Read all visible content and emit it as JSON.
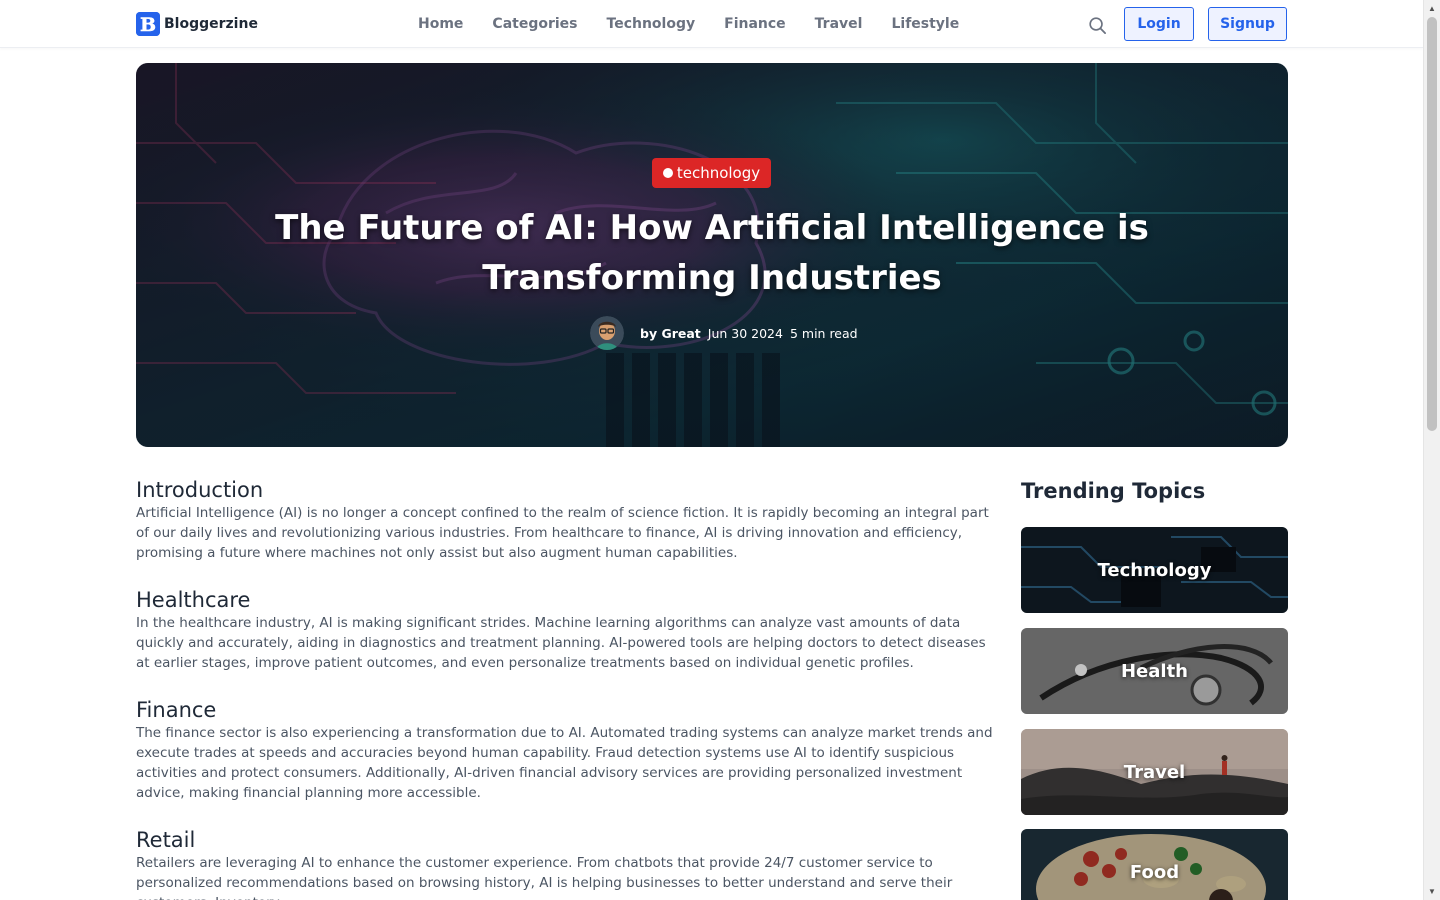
{
  "brand": {
    "name": "Bloggerzine",
    "logo_letter": "B",
    "logo_icon": "b-logo-icon"
  },
  "nav": {
    "links": [
      "Home",
      "Categories",
      "Technology",
      "Finance",
      "Travel",
      "Lifestyle"
    ],
    "search_icon": "search-icon",
    "login_label": "Login",
    "signup_label": "Signup"
  },
  "hero": {
    "tag": "technology",
    "title": "The Future of AI: How Artificial Intelligence is Transforming Industries",
    "author": "by Great",
    "date": "Jun 30 2024",
    "read_time": "5 min read",
    "avatar_icon": "avatar-icon"
  },
  "article": {
    "sections": [
      {
        "heading": "Introduction",
        "body": "Artificial Intelligence (AI) is no longer a concept confined to the realm of science fiction. It is rapidly becoming an integral part of our daily lives and revolutionizing various industries. From healthcare to finance, AI is driving innovation and efficiency, promising a future where machines not only assist but also augment human capabilities."
      },
      {
        "heading": "Healthcare",
        "body": "In the healthcare industry, AI is making significant strides. Machine learning algorithms can analyze vast amounts of data quickly and accurately, aiding in diagnostics and treatment planning. AI-powered tools are helping doctors to detect diseases at earlier stages, improve patient outcomes, and even personalize treatments based on individual genetic profiles."
      },
      {
        "heading": "Finance",
        "body": "The finance sector is also experiencing a transformation due to AI. Automated trading systems can analyze market trends and execute trades at speeds and accuracies beyond human capability. Fraud detection systems use AI to identify suspicious activities and protect consumers. Additionally, AI-driven financial advisory services are providing personalized investment advice, making financial planning more accessible."
      },
      {
        "heading": "Retail",
        "body": "Retailers are leveraging AI to enhance the customer experience. From chatbots that provide 24/7 customer service to personalized recommendations based on browsing history, AI is helping businesses to better understand and serve their customers. Inventory"
      }
    ]
  },
  "trending": {
    "title": "Trending Topics",
    "topics": [
      "Technology",
      "Health",
      "Travel",
      "Food"
    ]
  },
  "colors": {
    "accent": "#2563eb",
    "tag_red": "#dc2626",
    "nav_text": "#6b7280",
    "body_text": "#4b5563"
  }
}
